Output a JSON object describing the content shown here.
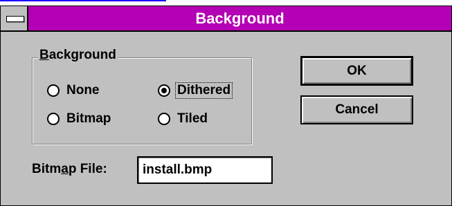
{
  "window": {
    "title": "Background"
  },
  "group": {
    "legend": "Background",
    "options": [
      {
        "label": "None",
        "selected": false
      },
      {
        "label": "Dithered",
        "selected": true
      },
      {
        "label": "Bitmap",
        "selected": false
      },
      {
        "label": "Tiled",
        "selected": false
      }
    ]
  },
  "buttons": {
    "ok": "OK",
    "cancel": "Cancel"
  },
  "bitmap_file": {
    "label": "Bitmap File:",
    "value": "install.bmp"
  },
  "colors": {
    "title_bar": "#b400b4",
    "face": "#c0c0c0"
  }
}
